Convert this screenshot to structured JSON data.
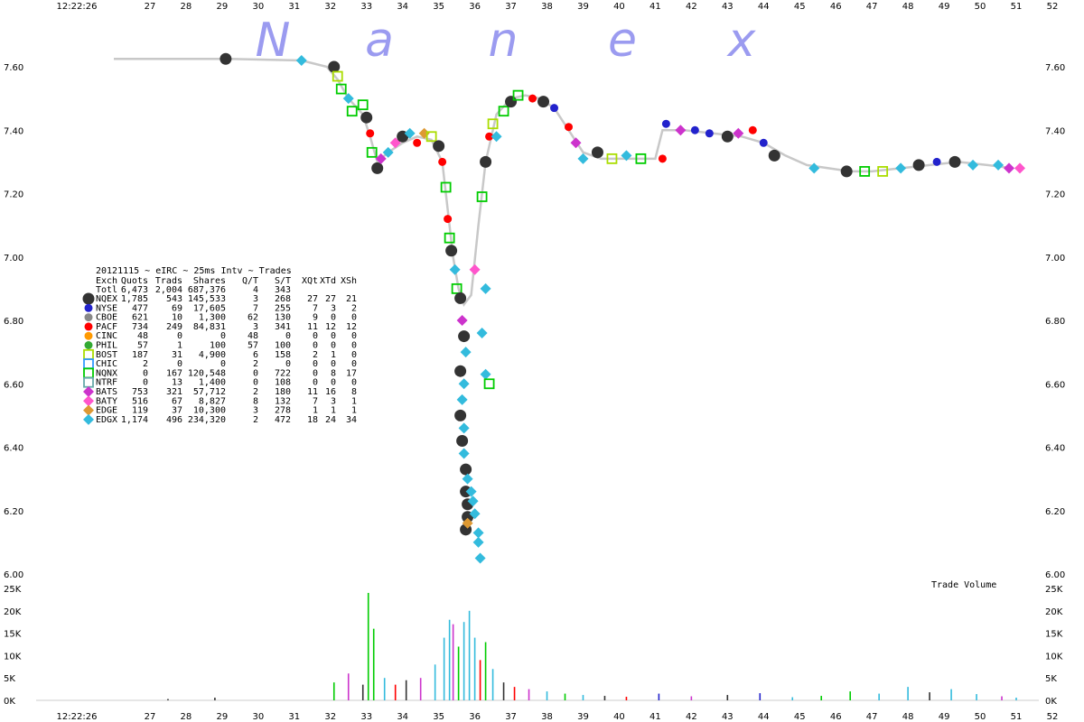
{
  "watermark": [
    "N",
    "a",
    "n",
    "e",
    "x"
  ],
  "chart_data": {
    "type": "scatter",
    "title": "20121115 ~ eIRC ~ 25ms Intv ~ Trades",
    "x_ticks": [
      "12:22:26",
      "27",
      "28",
      "29",
      "30",
      "31",
      "32",
      "33",
      "34",
      "35",
      "36",
      "37",
      "38",
      "39",
      "40",
      "41",
      "42",
      "43",
      "44",
      "45",
      "46",
      "47",
      "48",
      "49",
      "50",
      "51",
      "52"
    ],
    "y_ticks": [
      "7.60",
      "7.40",
      "7.20",
      "7.00",
      "6.80",
      "6.60",
      "6.40",
      "6.20",
      "6.00"
    ],
    "y_range": [
      6.0,
      7.6
    ],
    "volume_label": "Trade Volume",
    "volume_ticks": [
      "25K",
      "20K",
      "15K",
      "10K",
      "5K",
      "0K"
    ],
    "volume_range": [
      0,
      25000
    ],
    "legend_header": [
      "Exch",
      "Quots",
      "Trads",
      "Shares",
      "Q/T",
      "S/T",
      "XQt",
      "XTd",
      "XSh"
    ],
    "legend_total": [
      "Totl",
      "6,473",
      "2,004",
      "687,376",
      "4",
      "343",
      "",
      "",
      ""
    ],
    "legend_rows": [
      {
        "exch": "NQEX",
        "quots": "1,785",
        "trads": "543",
        "shares": "145,533",
        "qt": "3",
        "st": "268",
        "xqt": "27",
        "xtd": "27",
        "xsh": "21",
        "color": "#333333",
        "shape": "circle-big"
      },
      {
        "exch": "NYSE",
        "quots": "477",
        "trads": "69",
        "shares": "17,605",
        "qt": "7",
        "st": "255",
        "xqt": "7",
        "xtd": "3",
        "xsh": "2",
        "color": "#2222cc",
        "shape": "circle"
      },
      {
        "exch": "CBOE",
        "quots": "621",
        "trads": "10",
        "shares": "1,300",
        "qt": "62",
        "st": "130",
        "xqt": "9",
        "xtd": "0",
        "xsh": "0",
        "color": "#888888",
        "shape": "circle"
      },
      {
        "exch": "PACF",
        "quots": "734",
        "trads": "249",
        "shares": "84,831",
        "qt": "3",
        "st": "341",
        "xqt": "11",
        "xtd": "12",
        "xsh": "12",
        "color": "#ff0000",
        "shape": "circle"
      },
      {
        "exch": "CINC",
        "quots": "48",
        "trads": "0",
        "shares": "0",
        "qt": "48",
        "st": "0",
        "xqt": "0",
        "xtd": "0",
        "xsh": "0",
        "color": "#ff9900",
        "shape": "circle"
      },
      {
        "exch": "PHIL",
        "quots": "57",
        "trads": "1",
        "shares": "100",
        "qt": "57",
        "st": "100",
        "xqt": "0",
        "xtd": "0",
        "xsh": "0",
        "color": "#33aa33",
        "shape": "circle"
      },
      {
        "exch": "BOST",
        "quots": "187",
        "trads": "31",
        "shares": "4,900",
        "qt": "6",
        "st": "158",
        "xqt": "2",
        "xtd": "1",
        "xsh": "0",
        "color": "#aadd00",
        "shape": "square"
      },
      {
        "exch": "CHIC",
        "quots": "2",
        "trads": "0",
        "shares": "0",
        "qt": "2",
        "st": "0",
        "xqt": "0",
        "xtd": "0",
        "xsh": "0",
        "color": "#3399ff",
        "shape": "square"
      },
      {
        "exch": "NQNX",
        "quots": "0",
        "trads": "167",
        "shares": "120,548",
        "qt": "0",
        "st": "722",
        "xqt": "0",
        "xtd": "8",
        "xsh": "17",
        "color": "#00cc00",
        "shape": "square"
      },
      {
        "exch": "NTRF",
        "quots": "0",
        "trads": "13",
        "shares": "1,400",
        "qt": "0",
        "st": "108",
        "xqt": "0",
        "xtd": "0",
        "xsh": "0",
        "color": "#66aaaa",
        "shape": "square"
      },
      {
        "exch": "BATS",
        "quots": "753",
        "trads": "321",
        "shares": "57,712",
        "qt": "2",
        "st": "180",
        "xqt": "11",
        "xtd": "16",
        "xsh": "8",
        "color": "#cc33cc",
        "shape": "diamond"
      },
      {
        "exch": "BATY",
        "quots": "516",
        "trads": "67",
        "shares": "8,827",
        "qt": "8",
        "st": "132",
        "xqt": "7",
        "xtd": "3",
        "xsh": "1",
        "color": "#ff55cc",
        "shape": "diamond"
      },
      {
        "exch": "EDGE",
        "quots": "119",
        "trads": "37",
        "shares": "10,300",
        "qt": "3",
        "st": "278",
        "xqt": "1",
        "xtd": "1",
        "xsh": "1",
        "color": "#dd9933",
        "shape": "diamond"
      },
      {
        "exch": "EDGX",
        "quots": "1,174",
        "trads": "496",
        "shares": "234,320",
        "qt": "2",
        "st": "472",
        "xqt": "18",
        "xtd": "24",
        "xsh": "34",
        "color": "#33bbdd",
        "shape": "diamond"
      }
    ],
    "price_path": [
      [
        27.0,
        7.625
      ],
      [
        30.1,
        7.625
      ],
      [
        32.2,
        7.62
      ],
      [
        32.9,
        7.6
      ],
      [
        33.2,
        7.56
      ],
      [
        33.5,
        7.5
      ],
      [
        33.9,
        7.45
      ],
      [
        34.1,
        7.38
      ],
      [
        34.3,
        7.3
      ],
      [
        34.6,
        7.33
      ],
      [
        35.0,
        7.36
      ],
      [
        35.4,
        7.38
      ],
      [
        35.8,
        7.37
      ],
      [
        36.1,
        7.3
      ],
      [
        36.25,
        7.15
      ],
      [
        36.4,
        7.0
      ],
      [
        36.55,
        6.9
      ],
      [
        36.7,
        6.85
      ],
      [
        36.9,
        6.88
      ],
      [
        37.1,
        7.1
      ],
      [
        37.3,
        7.3
      ],
      [
        37.6,
        7.45
      ],
      [
        38.0,
        7.5
      ],
      [
        38.4,
        7.51
      ],
      [
        38.8,
        7.5
      ],
      [
        39.2,
        7.47
      ],
      [
        39.6,
        7.4
      ],
      [
        40.0,
        7.33
      ],
      [
        40.5,
        7.31
      ],
      [
        41.0,
        7.31
      ],
      [
        41.5,
        7.31
      ],
      [
        42.0,
        7.31
      ],
      [
        42.2,
        7.4
      ],
      [
        42.8,
        7.4
      ],
      [
        43.6,
        7.39
      ],
      [
        44.4,
        7.38
      ],
      [
        45.0,
        7.36
      ],
      [
        45.6,
        7.32
      ],
      [
        46.2,
        7.29
      ],
      [
        46.8,
        7.28
      ],
      [
        47.4,
        7.27
      ],
      [
        48.0,
        7.27
      ],
      [
        48.8,
        7.28
      ],
      [
        49.6,
        7.29
      ],
      [
        50.4,
        7.3
      ],
      [
        51.2,
        7.29
      ],
      [
        51.9,
        7.28
      ]
    ],
    "trades": [
      {
        "x": 30.1,
        "y": 7.625,
        "exch": "NQEX"
      },
      {
        "x": 32.2,
        "y": 7.62,
        "exch": "EDGX"
      },
      {
        "x": 33.1,
        "y": 7.6,
        "exch": "NQEX"
      },
      {
        "x": 33.2,
        "y": 7.57,
        "exch": "BOST"
      },
      {
        "x": 33.3,
        "y": 7.53,
        "exch": "NQNX"
      },
      {
        "x": 33.5,
        "y": 7.5,
        "exch": "EDGX"
      },
      {
        "x": 33.6,
        "y": 7.46,
        "exch": "NQNX"
      },
      {
        "x": 33.9,
        "y": 7.48,
        "exch": "NQNX"
      },
      {
        "x": 34.0,
        "y": 7.44,
        "exch": "NQEX"
      },
      {
        "x": 34.1,
        "y": 7.39,
        "exch": "PACF"
      },
      {
        "x": 34.15,
        "y": 7.33,
        "exch": "NQNX"
      },
      {
        "x": 34.3,
        "y": 7.28,
        "exch": "NQEX"
      },
      {
        "x": 34.4,
        "y": 7.31,
        "exch": "BATS"
      },
      {
        "x": 34.6,
        "y": 7.33,
        "exch": "EDGX"
      },
      {
        "x": 34.8,
        "y": 7.36,
        "exch": "BATY"
      },
      {
        "x": 35.0,
        "y": 7.38,
        "exch": "NQEX"
      },
      {
        "x": 35.2,
        "y": 7.39,
        "exch": "EDGX"
      },
      {
        "x": 35.4,
        "y": 7.36,
        "exch": "PACF"
      },
      {
        "x": 35.6,
        "y": 7.39,
        "exch": "EDGE"
      },
      {
        "x": 35.8,
        "y": 7.38,
        "exch": "BOST"
      },
      {
        "x": 36.0,
        "y": 7.35,
        "exch": "NQEX"
      },
      {
        "x": 36.1,
        "y": 7.3,
        "exch": "PACF"
      },
      {
        "x": 36.2,
        "y": 7.22,
        "exch": "NQNX"
      },
      {
        "x": 36.25,
        "y": 7.12,
        "exch": "PACF"
      },
      {
        "x": 36.3,
        "y": 7.06,
        "exch": "NQNX"
      },
      {
        "x": 36.35,
        "y": 7.02,
        "exch": "NQEX"
      },
      {
        "x": 36.45,
        "y": 6.96,
        "exch": "EDGX"
      },
      {
        "x": 36.5,
        "y": 6.9,
        "exch": "NQNX"
      },
      {
        "x": 36.6,
        "y": 6.87,
        "exch": "NQEX"
      },
      {
        "x": 36.65,
        "y": 6.8,
        "exch": "BATS"
      },
      {
        "x": 36.7,
        "y": 6.75,
        "exch": "NQEX"
      },
      {
        "x": 36.75,
        "y": 6.7,
        "exch": "EDGX"
      },
      {
        "x": 36.6,
        "y": 6.64,
        "exch": "NQEX"
      },
      {
        "x": 36.7,
        "y": 6.6,
        "exch": "EDGX"
      },
      {
        "x": 36.65,
        "y": 6.55,
        "exch": "EDGX"
      },
      {
        "x": 36.6,
        "y": 6.5,
        "exch": "NQEX"
      },
      {
        "x": 36.7,
        "y": 6.46,
        "exch": "EDGX"
      },
      {
        "x": 36.65,
        "y": 6.42,
        "exch": "NQEX"
      },
      {
        "x": 36.7,
        "y": 6.38,
        "exch": "EDGX"
      },
      {
        "x": 36.75,
        "y": 6.33,
        "exch": "NQEX"
      },
      {
        "x": 36.8,
        "y": 6.3,
        "exch": "EDGX"
      },
      {
        "x": 36.75,
        "y": 6.26,
        "exch": "NQEX"
      },
      {
        "x": 36.9,
        "y": 6.26,
        "exch": "EDGX"
      },
      {
        "x": 36.8,
        "y": 6.22,
        "exch": "NQEX"
      },
      {
        "x": 36.95,
        "y": 6.23,
        "exch": "EDGX"
      },
      {
        "x": 36.8,
        "y": 6.18,
        "exch": "NQEX"
      },
      {
        "x": 37.0,
        "y": 6.19,
        "exch": "EDGX"
      },
      {
        "x": 36.75,
        "y": 6.14,
        "exch": "NQEX"
      },
      {
        "x": 37.1,
        "y": 6.13,
        "exch": "EDGX"
      },
      {
        "x": 37.1,
        "y": 6.1,
        "exch": "EDGX"
      },
      {
        "x": 37.15,
        "y": 6.05,
        "exch": "EDGX"
      },
      {
        "x": 36.8,
        "y": 6.16,
        "exch": "EDGE"
      },
      {
        "x": 37.3,
        "y": 6.9,
        "exch": "EDGX"
      },
      {
        "x": 37.2,
        "y": 6.76,
        "exch": "EDGX"
      },
      {
        "x": 37.3,
        "y": 6.63,
        "exch": "EDGX"
      },
      {
        "x": 37.4,
        "y": 6.6,
        "exch": "NQNX"
      },
      {
        "x": 37.0,
        "y": 6.96,
        "exch": "BATY"
      },
      {
        "x": 37.2,
        "y": 7.19,
        "exch": "NQNX"
      },
      {
        "x": 37.3,
        "y": 7.3,
        "exch": "NQEX"
      },
      {
        "x": 37.4,
        "y": 7.38,
        "exch": "PACF"
      },
      {
        "x": 37.5,
        "y": 7.42,
        "exch": "BOST"
      },
      {
        "x": 37.6,
        "y": 7.38,
        "exch": "EDGX"
      },
      {
        "x": 37.8,
        "y": 7.46,
        "exch": "NQNX"
      },
      {
        "x": 38.0,
        "y": 7.49,
        "exch": "NQEX"
      },
      {
        "x": 38.2,
        "y": 7.51,
        "exch": "NQNX"
      },
      {
        "x": 38.6,
        "y": 7.5,
        "exch": "PACF"
      },
      {
        "x": 38.9,
        "y": 7.49,
        "exch": "NQEX"
      },
      {
        "x": 39.2,
        "y": 7.47,
        "exch": "NYSE"
      },
      {
        "x": 39.6,
        "y": 7.41,
        "exch": "PACF"
      },
      {
        "x": 39.8,
        "y": 7.36,
        "exch": "BATS"
      },
      {
        "x": 40.0,
        "y": 7.31,
        "exch": "EDGX"
      },
      {
        "x": 40.4,
        "y": 7.33,
        "exch": "NQEX"
      },
      {
        "x": 40.8,
        "y": 7.31,
        "exch": "BOST"
      },
      {
        "x": 41.2,
        "y": 7.32,
        "exch": "EDGX"
      },
      {
        "x": 41.6,
        "y": 7.31,
        "exch": "NQNX"
      },
      {
        "x": 42.2,
        "y": 7.31,
        "exch": "PACF"
      },
      {
        "x": 42.3,
        "y": 7.42,
        "exch": "NYSE"
      },
      {
        "x": 42.7,
        "y": 7.4,
        "exch": "BATS"
      },
      {
        "x": 43.1,
        "y": 7.4,
        "exch": "NYSE"
      },
      {
        "x": 43.5,
        "y": 7.39,
        "exch": "NYSE"
      },
      {
        "x": 44.0,
        "y": 7.38,
        "exch": "NQEX"
      },
      {
        "x": 44.3,
        "y": 7.39,
        "exch": "BATS"
      },
      {
        "x": 44.7,
        "y": 7.4,
        "exch": "PACF"
      },
      {
        "x": 45.0,
        "y": 7.36,
        "exch": "NYSE"
      },
      {
        "x": 45.3,
        "y": 7.32,
        "exch": "NQEX"
      },
      {
        "x": 46.4,
        "y": 7.28,
        "exch": "EDGX"
      },
      {
        "x": 47.3,
        "y": 7.27,
        "exch": "NQEX"
      },
      {
        "x": 47.8,
        "y": 7.27,
        "exch": "NQNX"
      },
      {
        "x": 48.3,
        "y": 7.27,
        "exch": "BOST"
      },
      {
        "x": 48.8,
        "y": 7.28,
        "exch": "EDGX"
      },
      {
        "x": 49.3,
        "y": 7.29,
        "exch": "NQEX"
      },
      {
        "x": 49.8,
        "y": 7.3,
        "exch": "NYSE"
      },
      {
        "x": 50.3,
        "y": 7.3,
        "exch": "NQEX"
      },
      {
        "x": 50.8,
        "y": 7.29,
        "exch": "EDGX"
      },
      {
        "x": 51.5,
        "y": 7.29,
        "exch": "EDGX"
      },
      {
        "x": 51.8,
        "y": 7.28,
        "exch": "BATS"
      },
      {
        "x": 52.1,
        "y": 7.28,
        "exch": "BATY"
      }
    ],
    "volume": [
      {
        "x": 33.1,
        "v": 4000,
        "exch": "NQNX"
      },
      {
        "x": 33.5,
        "v": 6000,
        "exch": "BATS"
      },
      {
        "x": 33.9,
        "v": 3500,
        "exch": "NQEX"
      },
      {
        "x": 34.05,
        "v": 24000,
        "exch": "NQNX"
      },
      {
        "x": 34.2,
        "v": 16000,
        "exch": "NQNX"
      },
      {
        "x": 34.5,
        "v": 5000,
        "exch": "EDGX"
      },
      {
        "x": 34.8,
        "v": 3500,
        "exch": "PACF"
      },
      {
        "x": 35.1,
        "v": 4500,
        "exch": "NQEX"
      },
      {
        "x": 35.5,
        "v": 5000,
        "exch": "BATS"
      },
      {
        "x": 35.9,
        "v": 8000,
        "exch": "EDGX"
      },
      {
        "x": 36.15,
        "v": 14000,
        "exch": "EDGX"
      },
      {
        "x": 36.3,
        "v": 18000,
        "exch": "EDGX"
      },
      {
        "x": 36.4,
        "v": 17000,
        "exch": "BATS"
      },
      {
        "x": 36.55,
        "v": 12000,
        "exch": "NQNX"
      },
      {
        "x": 36.7,
        "v": 17500,
        "exch": "EDGX"
      },
      {
        "x": 36.85,
        "v": 20000,
        "exch": "EDGX"
      },
      {
        "x": 37.0,
        "v": 14000,
        "exch": "EDGX"
      },
      {
        "x": 37.15,
        "v": 9000,
        "exch": "PACF"
      },
      {
        "x": 37.3,
        "v": 13000,
        "exch": "NQNX"
      },
      {
        "x": 37.5,
        "v": 7000,
        "exch": "EDGX"
      },
      {
        "x": 37.8,
        "v": 4000,
        "exch": "NQEX"
      },
      {
        "x": 38.1,
        "v": 3000,
        "exch": "PACF"
      },
      {
        "x": 38.5,
        "v": 2500,
        "exch": "BATS"
      },
      {
        "x": 39.0,
        "v": 2000,
        "exch": "EDGX"
      },
      {
        "x": 39.5,
        "v": 1500,
        "exch": "NQNX"
      },
      {
        "x": 40.0,
        "v": 1200,
        "exch": "EDGX"
      },
      {
        "x": 40.6,
        "v": 1000,
        "exch": "NQEX"
      },
      {
        "x": 41.2,
        "v": 800,
        "exch": "PACF"
      },
      {
        "x": 42.1,
        "v": 1500,
        "exch": "NYSE"
      },
      {
        "x": 43.0,
        "v": 900,
        "exch": "BATS"
      },
      {
        "x": 44.0,
        "v": 1200,
        "exch": "NQEX"
      },
      {
        "x": 44.9,
        "v": 1600,
        "exch": "NYSE"
      },
      {
        "x": 45.8,
        "v": 700,
        "exch": "EDGX"
      },
      {
        "x": 46.6,
        "v": 1000,
        "exch": "NQNX"
      },
      {
        "x": 47.4,
        "v": 2000,
        "exch": "NQNX"
      },
      {
        "x": 48.2,
        "v": 1500,
        "exch": "EDGX"
      },
      {
        "x": 49.0,
        "v": 3000,
        "exch": "EDGX"
      },
      {
        "x": 49.6,
        "v": 1800,
        "exch": "NQEX"
      },
      {
        "x": 50.2,
        "v": 2500,
        "exch": "EDGX"
      },
      {
        "x": 50.9,
        "v": 1400,
        "exch": "EDGX"
      },
      {
        "x": 51.6,
        "v": 900,
        "exch": "BATS"
      },
      {
        "x": 52.0,
        "v": 600,
        "exch": "EDGX"
      },
      {
        "x": 29.8,
        "v": 600,
        "exch": "NQEX"
      },
      {
        "x": 28.5,
        "v": 300,
        "exch": "NQEX"
      }
    ]
  }
}
